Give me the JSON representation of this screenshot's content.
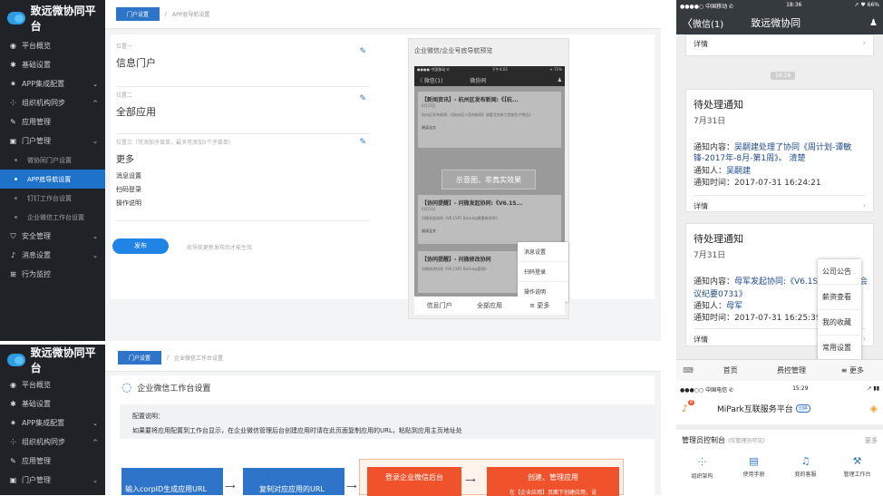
{
  "top_admin": {
    "brand": "致远微协同平台",
    "nav": [
      {
        "label": "平台概览",
        "icon": "dashboard-icon",
        "glyph": "◉"
      },
      {
        "label": "基础设置",
        "icon": "gear-icon",
        "glyph": "✱"
      },
      {
        "label": "APP集成配置",
        "icon": "settings-icon",
        "glyph": "✷",
        "chev": "⌄"
      },
      {
        "label": "组织机构同步",
        "icon": "org-icon",
        "glyph": "⸭",
        "chev": "^"
      },
      {
        "label": "应用管理",
        "icon": "wrench-icon",
        "glyph": "✎"
      },
      {
        "label": "门户管理",
        "icon": "portal-icon",
        "glyph": "▣",
        "chev": "⌄"
      }
    ],
    "subnav": [
      "微协同门户设置",
      "APP底导航设置",
      "钉钉工作台设置",
      "企业微信工作台设置"
    ],
    "nav2": [
      {
        "label": "安全管理",
        "icon": "shield-icon",
        "glyph": "⛉",
        "chev": "⌄"
      },
      {
        "label": "消息设置",
        "icon": "bell-icon",
        "glyph": "♪",
        "chev": "⌄"
      },
      {
        "label": "行为监控",
        "icon": "monitor-icon",
        "glyph": "⊞"
      }
    ],
    "crumb_active": "门户设置",
    "crumb_sep": "/",
    "crumb_current": "APP底导航设置",
    "fields": [
      {
        "label": "位置一",
        "value": "信息门户"
      },
      {
        "label": "位置二",
        "value": "全部应用"
      },
      {
        "label": "位置三（可添加子菜单，最多可添加5个子菜单）",
        "value": "更多"
      }
    ],
    "submenus": [
      "消息设置",
      "扫码登录",
      "操作说明"
    ],
    "publish": "发布",
    "publish_hint": "底导航更新发布后才能生效",
    "preview_title": "企业微信/企业号底导航预览",
    "preview": {
      "status_left": "●●●● 中国移动 ✆",
      "status_time": "下午4:03",
      "status_right": "✈ 71%",
      "back": "〈 微信(1)",
      "nav_title": "微协同",
      "card1_title": "【新闻资讯】- 杭州区发布新闻:《【杭...",
      "card1_date": "6月23日",
      "card1_body": "杭州区发布新闻:《【杭州区+亚的新闻】请看北京新工程部生产物品》",
      "read_more": "阅读全文",
      "overlay": "示意图，非真实效果",
      "card2_title": "【协同提醒】- 问微发起协同:《V6.1S...",
      "card2_date": "6月23日",
      "card2_body": "问微发起协同《V6.1SP1 Backlog需重新排序》",
      "card3_title": "【协同提醒】- 问微修改协同",
      "card3_body": "问微修改协同《V6.1SP1 Backlog管理》",
      "menu": [
        "消息设置",
        "扫码登录",
        "操作说明"
      ],
      "tabs": [
        "信息门户",
        "全部应用",
        "≡ 更多"
      ]
    }
  },
  "bottom_admin": {
    "brand": "致远微协同平台",
    "nav": [
      {
        "label": "平台概览",
        "icon": "dashboard-icon",
        "glyph": "◉"
      },
      {
        "label": "基础设置",
        "icon": "gear-icon",
        "glyph": "✱"
      },
      {
        "label": "APP集成配置",
        "icon": "settings-icon",
        "glyph": "✷",
        "chev": "⌄"
      },
      {
        "label": "组织机构同步",
        "icon": "org-icon",
        "glyph": "⸭",
        "chev": "^"
      },
      {
        "label": "应用管理",
        "icon": "wrench-icon",
        "glyph": "✎"
      },
      {
        "label": "门户管理",
        "icon": "portal-icon",
        "glyph": "▣",
        "chev": "⌄"
      }
    ],
    "crumb_active": "门户设置",
    "crumb_sep": "/",
    "crumb_current": "企业微信工作台设置",
    "page_title": "企业微信工作台设置",
    "config_title": "配置说明：",
    "config_body": "如果要将应用配置到工作台显示，在企业微信管理后台创建应用时请在此页面复制应用的URL，粘贴到应用主页地址处",
    "steps": [
      "输入corpID生成应用URL",
      "复制对应应用的URL",
      "登录企业微信后台",
      "创建、管理应用",
      "在【企业应用】页面下创建应用，设"
    ]
  },
  "phone1": {
    "status_left": "●●●●○ 中国移动 ✆",
    "status_time": "18:36",
    "status_right": "↗ ♥ 66%",
    "back": "微信(1)",
    "title": "致远微协同",
    "detail": "详情",
    "timestamp": "16:26",
    "cards": [
      {
        "title": "待处理通知",
        "date": "7月31日",
        "content_label": "通知内容：",
        "content": "吴嗣建处理了协同《周计划-谭敏锋-2017年-8月-第1周》。 清楚",
        "person_label": "通知人：",
        "person": "吴嗣建",
        "time_label": "通知时间：",
        "time": "2017-07-31 16:24:21",
        "detail": "详情"
      },
      {
        "title": "待处理通知",
        "date": "7月31日",
        "content_label": "通知内容：",
        "content": "母军发起协同:《V6.1SP",
        "content_tail": "会",
        "content2": "议纪要0731》",
        "person_label": "通知人：",
        "person": "母军",
        "time_label": "通知时间：",
        "time": "2017-07-31 16:25:39",
        "detail": "详情"
      }
    ],
    "popup": [
      "公司公告",
      "薪资查看",
      "我的收藏",
      "常用设置"
    ],
    "tabs": [
      "首页",
      "费控管理",
      "≡ 更多"
    ]
  },
  "phone2": {
    "status_left": "●●●○○ 中国电信 ✆",
    "status_time": "15:29",
    "status_right": "↗ ▮▮",
    "badge": "8",
    "title": "MiPark互联服务平台",
    "title_tag": "切换",
    "section": "管理员控制台",
    "section_note": "(仅管理员可见)",
    "more": "更多",
    "icons": [
      {
        "label": "组织架构",
        "glyph": "⸭"
      },
      {
        "label": "使用手册",
        "glyph": "▤"
      },
      {
        "label": "我的客服",
        "glyph": "♫"
      },
      {
        "label": "管理工作台",
        "glyph": "⚒"
      }
    ]
  },
  "colors": {
    "sidebar": "#1f2328",
    "accent": "#2e74c8",
    "active": "#1f72c9",
    "orange": "#f0522b"
  }
}
